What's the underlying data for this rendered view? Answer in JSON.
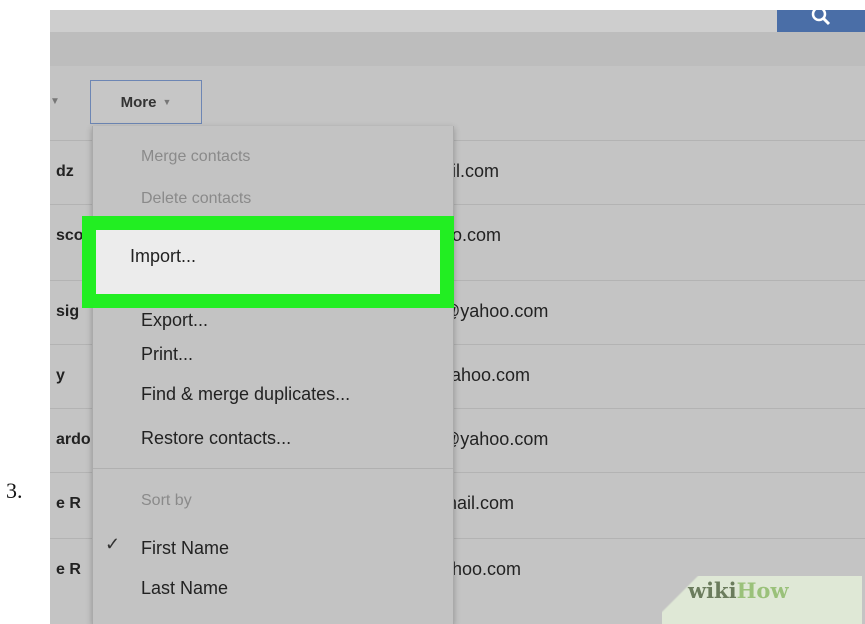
{
  "step_number": "3.",
  "toolbar": {
    "more_label": "More"
  },
  "contacts": [
    {
      "name": "dz",
      "email": "ail.com"
    },
    {
      "name": "sco",
      "email": "oo.com"
    },
    {
      "name": "sig",
      "email": "@yahoo.com"
    },
    {
      "name": "y",
      "email": "yahoo.com"
    },
    {
      "name": "ardo",
      "email": "@yahoo.com"
    },
    {
      "name": "e R",
      "email": "mail.com"
    },
    {
      "name": "e R",
      "email": "ahoo.com"
    }
  ],
  "menu": {
    "merge_contacts": "Merge contacts",
    "delete_contacts": "Delete contacts",
    "import": "Import...",
    "export": "Export...",
    "print": "Print...",
    "find_merge": "Find & merge duplicates...",
    "restore": "Restore contacts...",
    "sort_by": "Sort by",
    "first_name": "First Name",
    "last_name": "Last Name"
  },
  "watermark": {
    "part1": "wiki",
    "part2": "How"
  },
  "colors": {
    "highlight": "#22ee22",
    "search_button": "#4a6ea7"
  }
}
